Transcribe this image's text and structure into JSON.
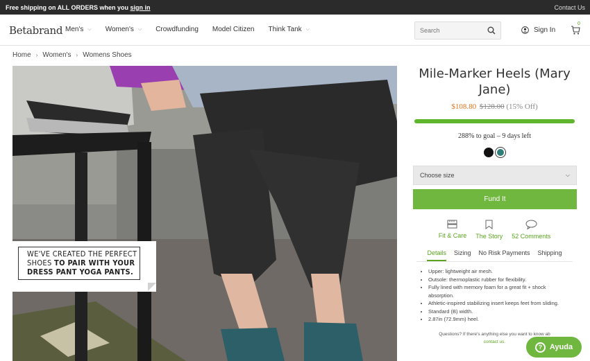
{
  "topbar": {
    "promo_prefix": "Free shipping on ALL ORDERS when you",
    "promo_link": "sign in",
    "contact": "Contact Us"
  },
  "header": {
    "logo": "Betabrand",
    "nav": [
      {
        "label": "Men's",
        "dropdown": true
      },
      {
        "label": "Women's",
        "dropdown": true
      },
      {
        "label": "Crowdfunding",
        "dropdown": false
      },
      {
        "label": "Model Citizen",
        "dropdown": false
      },
      {
        "label": "Think Tank",
        "dropdown": true
      }
    ],
    "search_placeholder": "Search",
    "sign_in": "Sign In",
    "cart_count": "0"
  },
  "breadcrumb": [
    "Home",
    "Women's",
    "Womens Shoes"
  ],
  "hero": {
    "callout_line1": "WE'VE CREATED THE PERFECT",
    "callout_line2a": "SHOES",
    "callout_line2b": "TO PAIR WITH YOUR",
    "callout_line3": "DRESS PANT YOGA PANTS."
  },
  "product": {
    "title": "Mile-Marker Heels (Mary Jane)",
    "sale_price": "$108.80",
    "original_price": "$128.00",
    "discount": "(15% Off)",
    "progress_fraction": 1.0,
    "goal_text": "288% to goal – 9 days left",
    "colors": [
      "#111111",
      "#2e7e7a"
    ],
    "size_placeholder": "Choose size",
    "fund_button": "Fund It",
    "info_links": [
      {
        "label": "Fit & Care",
        "icon": "ruler-icon"
      },
      {
        "label": "The Story",
        "icon": "bookmark-icon"
      },
      {
        "label": "52 Comments",
        "icon": "speech-bubble-icon"
      }
    ],
    "tabs": [
      "Details",
      "Sizing",
      "No Risk Payments",
      "Shipping"
    ],
    "details": [
      "Upper: lightweight air mesh.",
      "Outsole: thermoplastic rubber for flexibility.",
      "Fully lined with memory foam for a great fit + shock absorption.",
      "Athletic-inspired stabilizing insert keeps feet from sliding.",
      "Standard (B) width.",
      "2.87in (72.9mm) heel."
    ],
    "questions_text": "Questions? If there's anything else you want to know ab",
    "questions_link": "contact us."
  },
  "help": {
    "label": "Ayuda"
  },
  "colors": {
    "accent_green": "#70b73f",
    "sale_orange": "#e8721a",
    "topbar": "#2b2b2b"
  }
}
